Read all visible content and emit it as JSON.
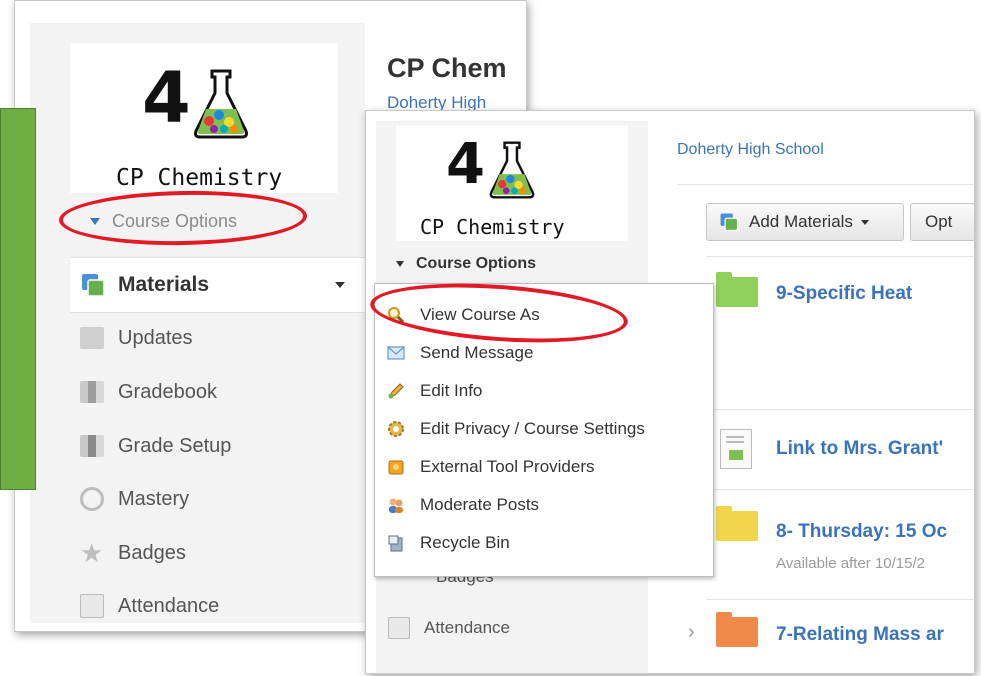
{
  "back_panel": {
    "logo_number": "4",
    "logo_name": "CP Chemistry",
    "course_options": "Course Options",
    "course_title": "CP Chem",
    "school": "Doherty High",
    "nav": [
      {
        "label": "Materials",
        "icon": "materials-icon"
      },
      {
        "label": "Updates",
        "icon": "updates-icon"
      },
      {
        "label": "Gradebook",
        "icon": "gradebook-icon"
      },
      {
        "label": "Grade Setup",
        "icon": "grade-setup-icon"
      },
      {
        "label": "Mastery",
        "icon": "mastery-icon"
      },
      {
        "label": "Badges",
        "icon": "badges-icon"
      },
      {
        "label": "Attendance",
        "icon": "attendance-icon"
      }
    ]
  },
  "front_panel": {
    "logo_number": "4",
    "logo_name": "CP Chemistry",
    "course_options": "Course Options",
    "school": "Doherty High School",
    "add_materials": "Add Materials",
    "options_partial": "Opt",
    "behind_badges": "Badges",
    "attendance": "Attendance",
    "menu": [
      {
        "label": "View Course As",
        "icon": "magnifier-icon"
      },
      {
        "label": "Send Message",
        "icon": "envelope-icon"
      },
      {
        "label": "Edit Info",
        "icon": "pencil-icon"
      },
      {
        "label": "Edit Privacy / Course Settings",
        "icon": "gear-icon"
      },
      {
        "label": "External Tool Providers",
        "icon": "puzzle-icon"
      },
      {
        "label": "Moderate Posts",
        "icon": "users-icon"
      },
      {
        "label": "Recycle Bin",
        "icon": "recycle-bin-icon"
      }
    ],
    "items": [
      {
        "title": "9-Specific Heat",
        "subtitle": "",
        "kind": "folder",
        "color": "#8fcf5a"
      },
      {
        "title": "Link to Mrs. Grant'",
        "subtitle": "",
        "kind": "link",
        "color": "#bcbcbc"
      },
      {
        "title": "8- Thursday: 15 Oc",
        "subtitle": "Available after 10/15/2",
        "kind": "folder",
        "color": "#f1d64c"
      },
      {
        "title": "7-Relating Mass ar",
        "subtitle": "",
        "kind": "folder",
        "color": "#f08a4b"
      }
    ]
  },
  "colors": {
    "accent_red": "#e21a25",
    "link_blue": "#3b73b9",
    "callout_green": "#6fae45"
  }
}
